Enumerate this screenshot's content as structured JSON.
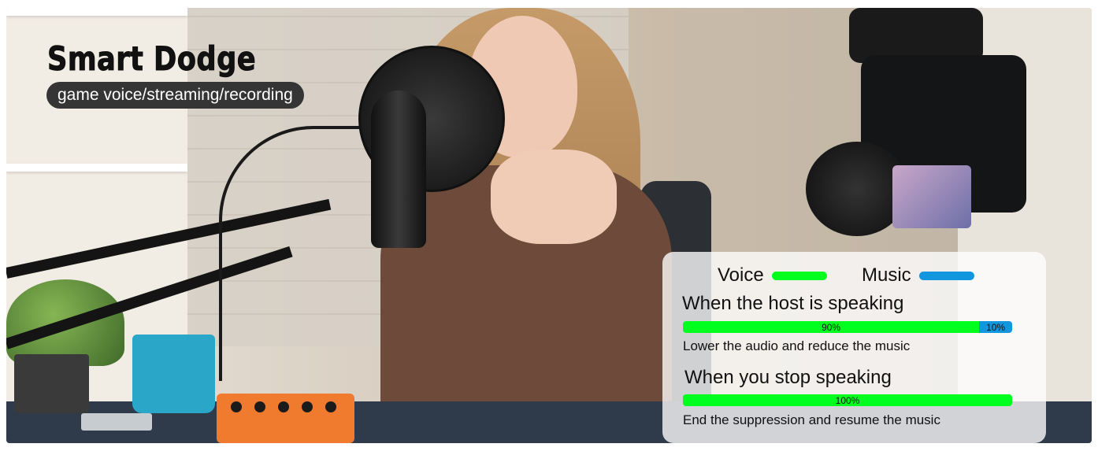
{
  "headline": "Smart Dodge",
  "subtitle": "game voice/streaming/recording",
  "legend": {
    "voice_label": "Voice",
    "voice_color": "#00ff1e",
    "music_label": "Music",
    "music_color": "#1296dd"
  },
  "speaking": {
    "title": "When the host is speaking",
    "voice_percent": 90,
    "music_percent": 10,
    "voice_text": "90%",
    "music_text": "10%",
    "caption": "Lower the audio and reduce the music"
  },
  "stopped": {
    "title": "When you stop speaking",
    "voice_percent": 100,
    "voice_text": "100%",
    "caption": "End the suppression and resume the music"
  }
}
